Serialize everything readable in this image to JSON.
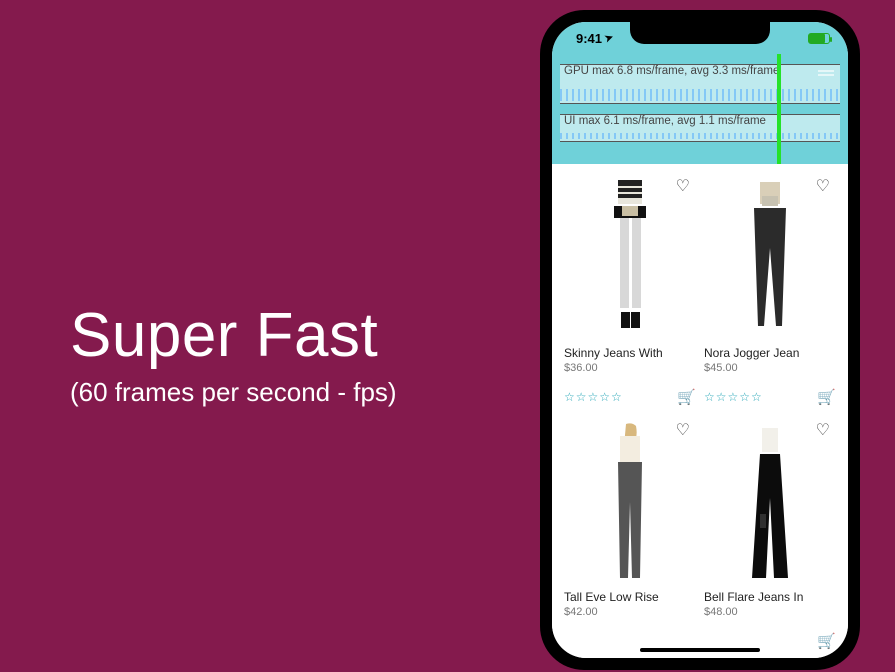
{
  "heading": {
    "title": "Super Fast",
    "subtitle": "(60 frames per second - fps)"
  },
  "status": {
    "time": "9:41",
    "battery_pct": 80
  },
  "perf": {
    "gpu_label": "GPU  max 6.8 ms/frame, avg 3.3 ms/frame",
    "ui_label": "UI  max 6.1 ms/frame, avg 1.1 ms/frame"
  },
  "icons": {
    "heart": "♡",
    "cart": "🛒",
    "star_empty": "☆",
    "location": "➤"
  },
  "products": [
    {
      "title": "Skinny Jeans With",
      "price": "$36.00",
      "rating": 0
    },
    {
      "title": "Nora Jogger Jean",
      "price": "$45.00",
      "rating": 0
    },
    {
      "title": "Tall Eve Low Rise",
      "price": "$42.00",
      "rating": 0
    },
    {
      "title": "Bell Flare Jeans In",
      "price": "$48.00",
      "rating": 0
    }
  ]
}
